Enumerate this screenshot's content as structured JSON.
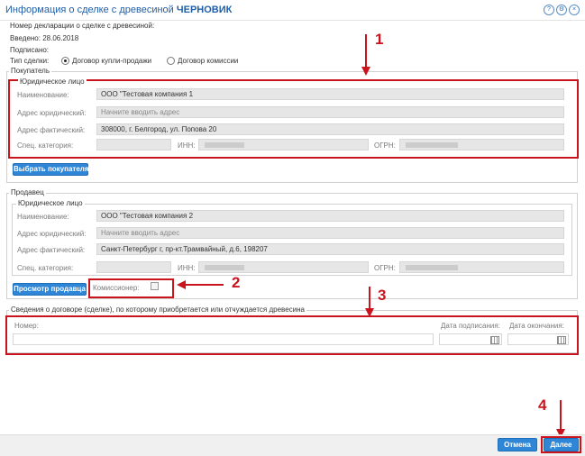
{
  "title": {
    "prefix": "Информация о сделке с древесиной",
    "status": "ЧЕРНОВИК"
  },
  "title_icons": [
    "help-icon",
    "settings-icon",
    "close-icon"
  ],
  "header": {
    "decl_number": "Номер декларации о сделке с древесиной:",
    "entered": "Введено: 28.06.2018",
    "signed": "Подписано:",
    "deal_type_label": "Тип сделки:",
    "deal_type_options": [
      "Договор купли-продажи",
      "Договор комиссии"
    ],
    "deal_type_selected": "Договор купли-продажи"
  },
  "buyer": {
    "section": "Покупатель",
    "legal_entity": "Юридическое лицо",
    "name_label": "Наименование:",
    "name_value": "ООО \"Тестовая компания 1",
    "legal_address_label": "Адрес юридический:",
    "legal_address_placeholder": "Начните вводить адрес",
    "actual_address_label": "Адрес фактический:",
    "actual_address_value": "308000, г. Белгород, ул. Попова 20",
    "category_label": "Спец. категория:",
    "inn_label": "ИНН:",
    "ogrn_label": "ОГРН:",
    "button": "Выбрать покупателя"
  },
  "seller": {
    "section": "Продавец",
    "legal_entity": "Юридическое лицо",
    "name_label": "Наименование:",
    "name_value": "ООО \"Тестовая компания 2",
    "legal_address_label": "Адрес юридический:",
    "legal_address_placeholder": "Начните вводить адрес",
    "actual_address_label": "Адрес фактический:",
    "actual_address_value": "Санкт-Петербург г, пр-кт.Трамвайный, д.6, 198207",
    "category_label": "Спец. категория:",
    "inn_label": "ИНН:",
    "ogrn_label": "ОГРН:",
    "button": "Просмотр продавца",
    "commissioner_label": "Комиссионер:",
    "commissioner_checked": false
  },
  "contract": {
    "section": "Сведения о договоре (сделке), по которому приобретается или отчуждается древесина",
    "number_label": "Номер:",
    "sign_date_label": "Дата подписания:",
    "end_date_label": "Дата окончания:"
  },
  "annotations": [
    "1",
    "2",
    "3",
    "4"
  ],
  "footer": {
    "cancel": "Отмена",
    "next": "Далее"
  },
  "colors": {
    "accent": "#2f86d6",
    "annotation": "#c9141e",
    "title": "#1f5fa8"
  }
}
